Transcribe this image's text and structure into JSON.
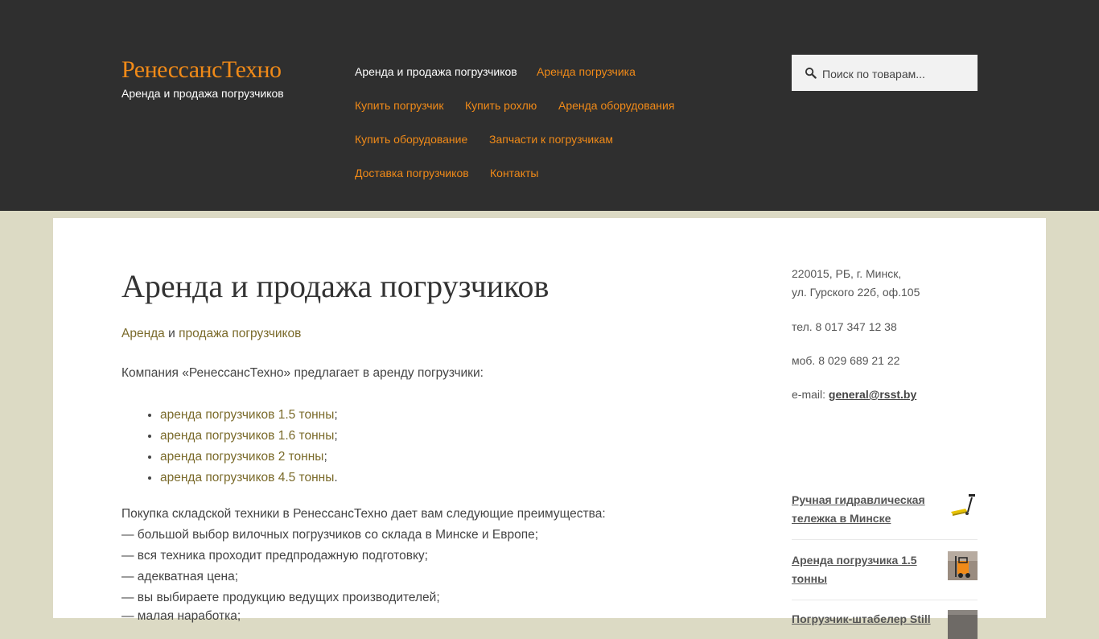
{
  "header": {
    "site_title": "РенессансТехно",
    "tagline": "Аренда и продажа погрузчиков",
    "nav": [
      {
        "label": "Аренда и продажа погрузчиков",
        "current": true
      },
      {
        "label": "Аренда погрузчика"
      },
      {
        "label": "Купить погрузчик"
      },
      {
        "label": "Купить рохлю"
      },
      {
        "label": "Аренда оборудования"
      },
      {
        "label": "Купить оборудование"
      },
      {
        "label": "Запчасти к погрузчикам"
      },
      {
        "label": "Доставка погрузчиков"
      },
      {
        "label": "Контакты"
      }
    ],
    "search": {
      "placeholder": "Поиск по товарам...",
      "value": ""
    }
  },
  "main": {
    "title": "Аренда и продажа погрузчиков",
    "intro": {
      "link1": "Аренда",
      "and": "и",
      "link2": "продажа погрузчиков"
    },
    "company_text": "Компания «РенессансТехно» предлагает в аренду погрузчики:",
    "rent_list": [
      {
        "link": "аренда погрузчиков 1.5 тонны",
        "punct": ";"
      },
      {
        "link": "аренда погрузчиков 1.6 тонны",
        "punct": ";"
      },
      {
        "link": "аренда погрузчиков 2 тонны",
        "punct": ";"
      },
      {
        "link": "аренда погрузчиков 4.5 тонны",
        "punct": "."
      }
    ],
    "advantages_title": "Покупка складской техники в РенессансТехно дает вам следующие преимущества:",
    "advantages": [
      "— большой выбор вилочных погрузчиков со склада в Минске и Европе;",
      "— вся техника проходит предпродажную подготовку;",
      "— адекватная цена;",
      "— вы выбираете продукцию ведущих производителей;",
      "— малая наработка;"
    ]
  },
  "sidebar": {
    "address_line1": "220015, РБ, г. Минск,",
    "address_line2": "ул. Гурского 22б, оф.105",
    "phone": "тел. 8 017 347 12 38",
    "mobile": "моб. 8 029 689 21 22",
    "email_label": "e-mail:",
    "email": "general@rsst.by",
    "products": [
      {
        "name": "Ручная гидравлическая тележка в Минске",
        "icon": "pallet-jack-thumbnail"
      },
      {
        "name": "Аренда погрузчика 1.5 тонны",
        "icon": "forklift-thumbnail"
      },
      {
        "name": "Погрузчик-штабелер Still",
        "icon": "stacker-thumbnail"
      }
    ]
  },
  "colors": {
    "header_bg": "#2f2f2f",
    "accent": "#f08a18",
    "link": "#7a6a2a",
    "page_bg": "#dcdac4"
  }
}
